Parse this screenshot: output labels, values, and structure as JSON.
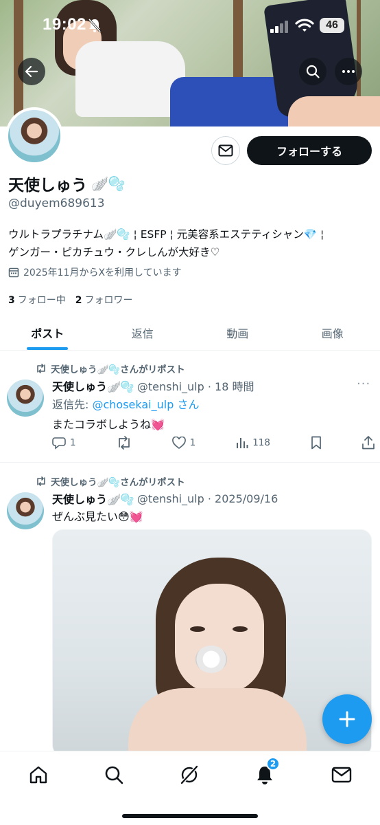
{
  "status_bar": {
    "time": "19:02",
    "battery": "46"
  },
  "profile": {
    "display_name": "天使しゅう",
    "name_emoji": "🪽🫧",
    "handle": "@duyem689613",
    "follow_label": "フォローする",
    "bio_line1": "ウルトラプラチナム🪽🫧 ¦ ESFP ¦ 元美容系エステティシャン💎 ¦",
    "bio_line2": "ゲンガー・ピカチュウ・クレしんが大好き♡",
    "joined": "2025年11月からXを利用しています",
    "following_count": "3",
    "following_label": "フォロー中",
    "followers_count": "2",
    "followers_label": "フォロワー"
  },
  "tabs": [
    {
      "label": "ポスト"
    },
    {
      "label": "返信"
    },
    {
      "label": "動画"
    },
    {
      "label": "画像"
    }
  ],
  "posts": [
    {
      "repost_label": "天使しゅう🪽🫧さんがリポスト",
      "name": "天使しゅう🪽🫧",
      "handle_time": "@tenshi_ulp · 18 時間",
      "reply_prefix": "返信先: ",
      "reply_link": "@chosekai_ulp",
      "reply_suffix": " さん",
      "text": "またコラボしようね💓",
      "replies": "1",
      "likes": "1",
      "views": "118"
    },
    {
      "repost_label": "天使しゅう🪽🫧さんがリポスト",
      "name": "天使しゅう🪽🫧",
      "handle_time": "@tenshi_ulp · 2025/09/16",
      "text": "ぜんぶ見たい😳💓"
    }
  ],
  "nav": {
    "notifications_badge": "2"
  },
  "colors": {
    "accent": "#1d9bf0",
    "text": "#0f1419",
    "secondary": "#536471"
  }
}
